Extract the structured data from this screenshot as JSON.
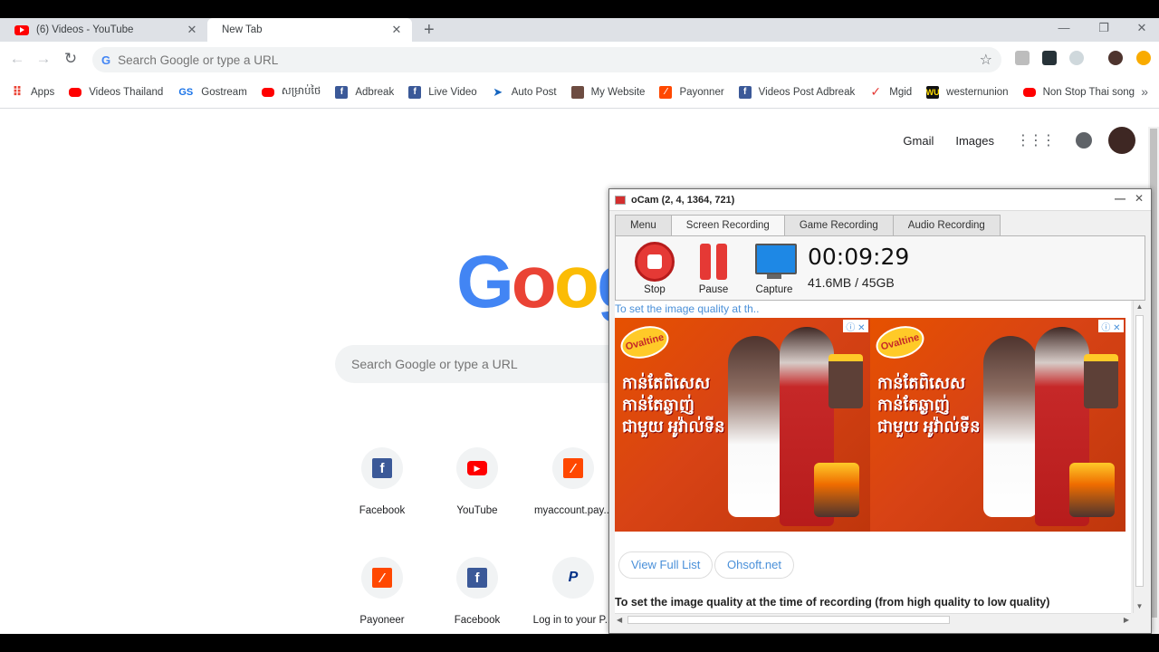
{
  "browser": {
    "tabs": [
      {
        "label": "(6) Videos - YouTube",
        "close": "✕"
      },
      {
        "label": "New Tab",
        "close": "✕"
      }
    ],
    "new_tab": "+",
    "window_controls": {
      "minimize": "—",
      "restore": "❐",
      "close": "✕"
    },
    "nav": {
      "back": "←",
      "forward": "→",
      "reload": "↻"
    },
    "omnibox": {
      "placeholder": "Search Google or type a URL",
      "g": "G",
      "star": "☆"
    },
    "bookmarks": [
      {
        "label": "Apps",
        "icon": "apps-icon"
      },
      {
        "label": "Videos Thailand",
        "icon": "youtube-icon"
      },
      {
        "label": "Gostream",
        "icon": "gostream-icon"
      },
      {
        "label": "សម្រាប់ថៃ",
        "icon": "youtube-icon"
      },
      {
        "label": "Adbreak",
        "icon": "facebook-icon"
      },
      {
        "label": "Live Video",
        "icon": "facebook-icon"
      },
      {
        "label": "Auto Post",
        "icon": "send-icon"
      },
      {
        "label": "My Website",
        "icon": "user-icon"
      },
      {
        "label": "Payonner",
        "icon": "payoneer-icon"
      },
      {
        "label": "Videos Post Adbreak",
        "icon": "facebook-icon"
      },
      {
        "label": "Mgid",
        "icon": "mgid-icon"
      },
      {
        "label": "westernunion",
        "icon": "westernunion-icon"
      },
      {
        "label": "Non Stop Thai song",
        "icon": "youtube-icon"
      }
    ],
    "bookmarks_more": "»"
  },
  "newtab": {
    "links": {
      "gmail": "Gmail",
      "images": "Images"
    },
    "apps_grid": "⋮⋮⋮",
    "search_placeholder": "Search Google or type a URL",
    "logo_letters": [
      "G",
      "o",
      "o",
      "g"
    ],
    "logo_colors": [
      "#4285f4",
      "#ea4335",
      "#fbbc05",
      "#4285f4"
    ],
    "shortcuts": [
      {
        "label": "Facebook",
        "icon": "facebook-icon",
        "glyph": "f"
      },
      {
        "label": "YouTube",
        "icon": "youtube-icon",
        "glyph": "▶"
      },
      {
        "label": "myaccount.pay...",
        "icon": "payoneer-icon",
        "glyph": "⁄"
      },
      {
        "label": "Payoneer",
        "icon": "payoneer-icon",
        "glyph": "⁄"
      },
      {
        "label": "Facebook",
        "icon": "facebook-icon",
        "glyph": "f"
      },
      {
        "label": "Log in to your P...",
        "icon": "paypal-icon",
        "glyph": "P"
      }
    ]
  },
  "ocam": {
    "title": "oCam (2, 4, 1364, 721)",
    "window_controls": {
      "minimize": "—",
      "close": "✕"
    },
    "tabs": [
      "Menu",
      "Screen Recording",
      "Game Recording",
      "Audio Recording"
    ],
    "active_tab": "Screen Recording",
    "buttons": {
      "stop": "Stop",
      "pause": "Pause",
      "capture": "Capture"
    },
    "timer": "00:09:29",
    "size": "41.6MB / 45GB",
    "web": {
      "header": "To set the image quality at th..",
      "ad": {
        "brand": "Ovaltine",
        "text": "កាន់តែពិសេស កាន់តែឆ្ងាញ់ ជាមួយ អូវ៉ាល់ទីន",
        "badge": "ⓘ ✕"
      },
      "buttons": [
        "View Full List",
        "Ohsoft.net"
      ],
      "footer": "To set the image quality at the time of recording (from high quality to low quality)"
    },
    "scroll_arrows": {
      "up": "▲",
      "down": "▼",
      "left": "◀",
      "right": "▶"
    }
  }
}
